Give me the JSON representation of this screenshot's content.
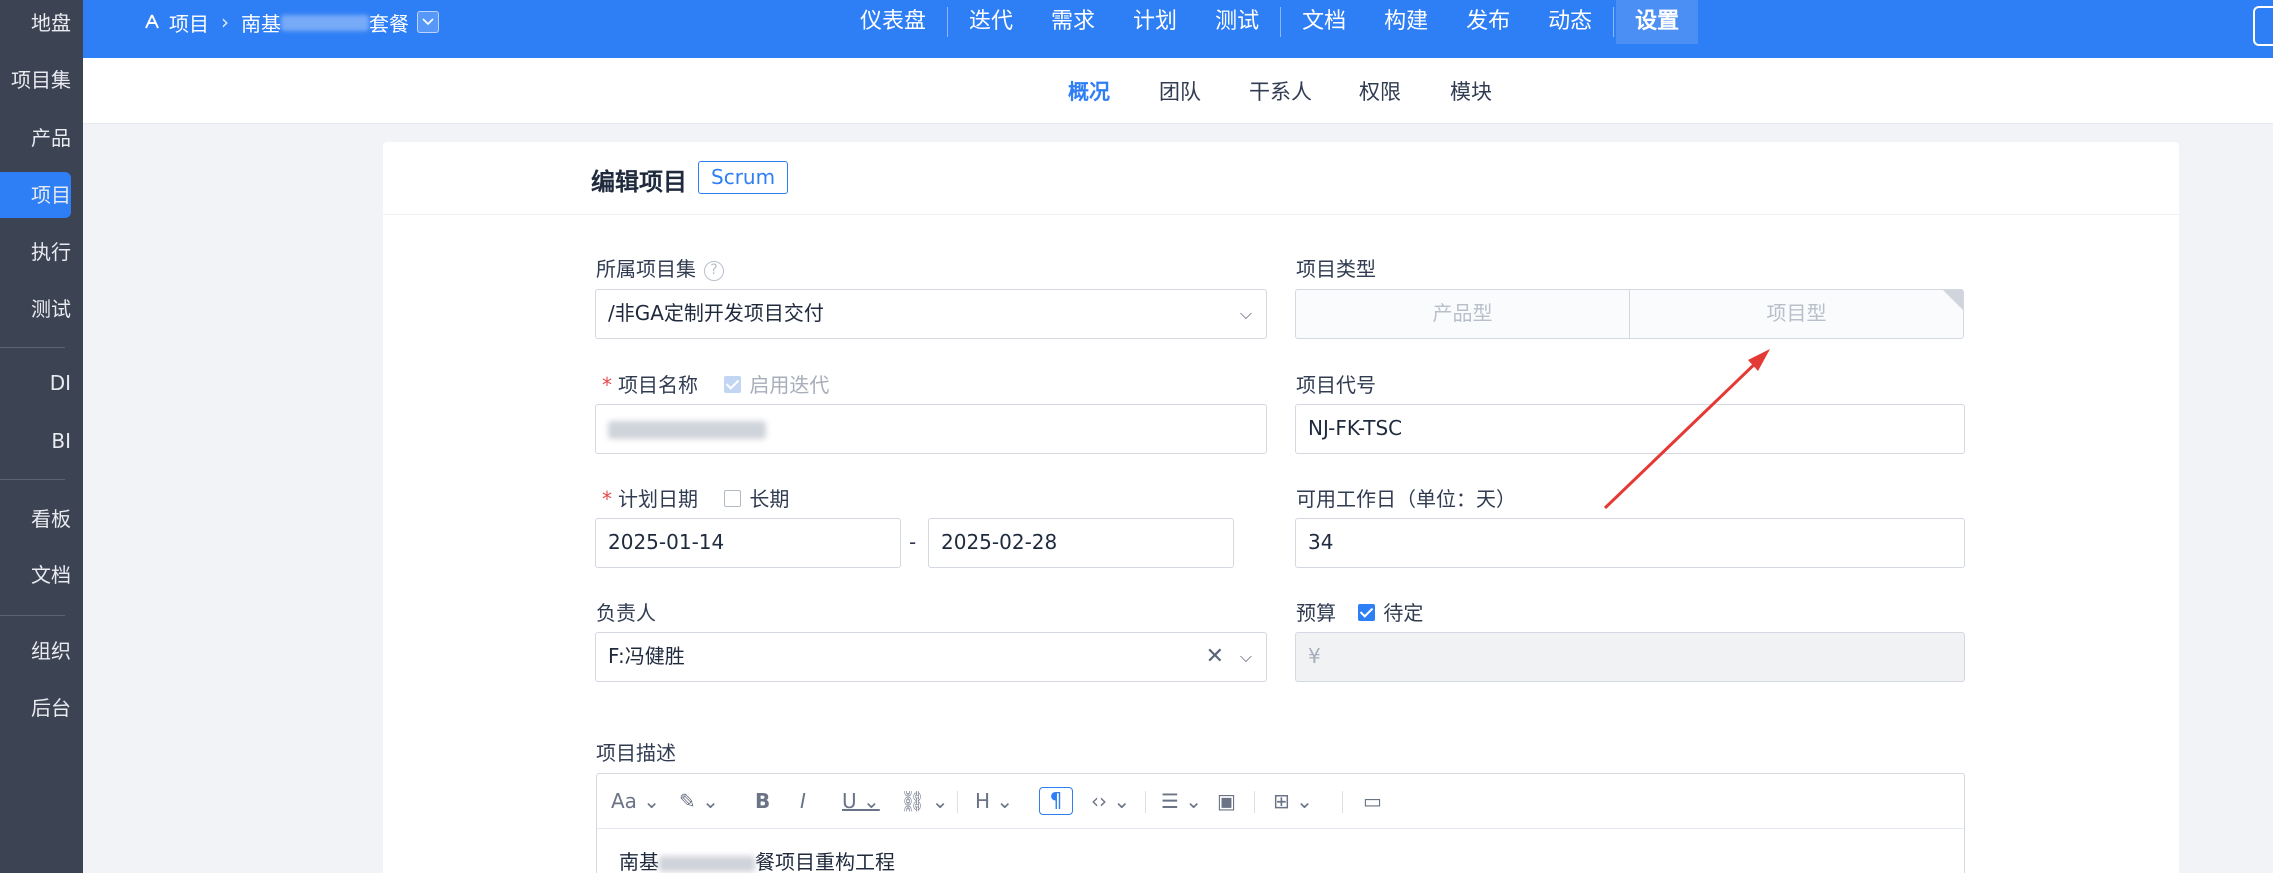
{
  "sidebar": {
    "items": [
      {
        "label": "地盘"
      },
      {
        "label": "项目集"
      },
      {
        "label": "产品"
      },
      {
        "label": "项目"
      },
      {
        "label": "执行"
      },
      {
        "label": "测试"
      },
      {
        "label": "DI"
      },
      {
        "label": "BI"
      },
      {
        "label": "看板"
      },
      {
        "label": "文档"
      },
      {
        "label": "组织"
      },
      {
        "label": "后台"
      }
    ]
  },
  "header": {
    "breadcrumb_root": "项目",
    "breadcrumb_project_prefix": "南基",
    "breadcrumb_project_suffix": "套餐",
    "nav": [
      "仪表盘",
      "迭代",
      "需求",
      "计划",
      "测试",
      "文档",
      "构建",
      "发布",
      "动态",
      "设置"
    ]
  },
  "subtabs": [
    "概况",
    "团队",
    "干系人",
    "权限",
    "模块"
  ],
  "form": {
    "title": "编辑项目",
    "badge": "Scrum",
    "program_label": "所属项目集",
    "program_value": "/非GA定制开发项目交付",
    "type_label": "项目类型",
    "type_options": [
      "产品型",
      "项目型"
    ],
    "name_label": "项目名称",
    "iteration_label": "启用迭代",
    "code_label": "项目代号",
    "code_value": "NJ-FK-TSC",
    "date_label": "计划日期",
    "longterm_label": "长期",
    "begin_date": "2025-01-14",
    "date_sep": "-",
    "end_date": "2025-02-28",
    "workdays_label": "可用工作日（单位：天）",
    "workdays_value": "34",
    "owner_label": "负责人",
    "owner_value": "F:冯健胜",
    "budget_label": "预算",
    "budget_pending_label": "待定",
    "budget_placeholder": "¥",
    "desc_label": "项目描述",
    "desc_prefix": "南基",
    "desc_suffix": "餐项目重构工程"
  },
  "colors": {
    "primary": "#2e7ef5",
    "sidebar": "#3c4353",
    "arrow": "#e53935"
  }
}
